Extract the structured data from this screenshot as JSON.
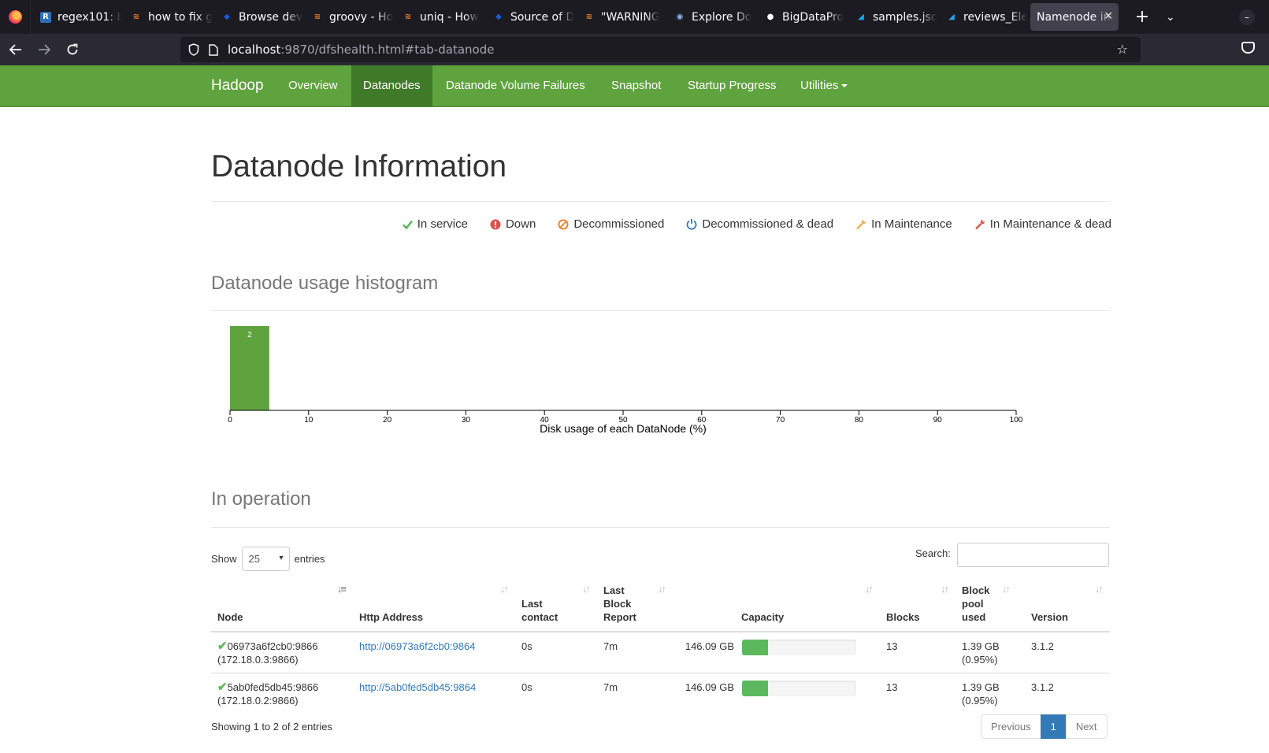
{
  "browser": {
    "tabs": [
      {
        "title": "regex101: b",
        "icon": "regex101-icon",
        "color": "#2f6fb5",
        "glyph": "R"
      },
      {
        "title": "how to fix g",
        "icon": "stackoverflow-icon",
        "color": "#f48024",
        "glyph": "≋"
      },
      {
        "title": "Browse dev",
        "icon": "bitwarden-shield-icon",
        "color": "#175ddc",
        "glyph": "◆"
      },
      {
        "title": "groovy - Ho",
        "icon": "stackoverflow-icon",
        "color": "#f48024",
        "glyph": "≋"
      },
      {
        "title": "uniq - How",
        "icon": "stackoverflow-icon",
        "color": "#f48024",
        "glyph": "≋"
      },
      {
        "title": "Source of D",
        "icon": "bitwarden-shield-icon",
        "color": "#175ddc",
        "glyph": "◆"
      },
      {
        "title": "\"WARNING",
        "icon": "stackoverflow-icon",
        "color": "#f48024",
        "glyph": "≋"
      },
      {
        "title": "Explore Do",
        "icon": "docker-icon",
        "color": "#8ab4f8",
        "glyph": "◉"
      },
      {
        "title": "BigDataPro",
        "icon": "github-icon",
        "color": "#ffffff",
        "glyph": "●"
      },
      {
        "title": "samples.jso",
        "icon": "elastic-icon",
        "color": "#1ba9f5",
        "glyph": "◢"
      },
      {
        "title": "reviews_Ele",
        "icon": "elastic-icon",
        "color": "#1ba9f5",
        "glyph": "◢"
      }
    ],
    "active_tab": {
      "title": "Namenode inf",
      "close": "×"
    },
    "new_tab": "+",
    "tab_list": "⌄",
    "url_host": "localhost",
    "url_rest": ":9870/dfshealth.html#tab-datanode"
  },
  "nav": {
    "brand": "Hadoop",
    "items": [
      "Overview",
      "Datanodes",
      "Datanode Volume Failures",
      "Snapshot",
      "Startup Progress",
      "Utilities"
    ]
  },
  "page": {
    "title": "Datanode Information",
    "legend": [
      {
        "label": "In service",
        "icon": "check-icon",
        "color": "#5cb85c"
      },
      {
        "label": "Down",
        "icon": "exclamation-circle-icon",
        "color": "#d9534f"
      },
      {
        "label": "Decommissioned",
        "icon": "ban-icon",
        "color": "#e67e22"
      },
      {
        "label": "Decommissioned & dead",
        "icon": "power-off-icon",
        "color": "#337ab7"
      },
      {
        "label": "In Maintenance",
        "icon": "wrench-icon",
        "color": "#f0ad4e"
      },
      {
        "label": "In Maintenance & dead",
        "icon": "wrench-icon",
        "color": "#d9534f"
      }
    ],
    "histogram_heading": "Datanode usage histogram",
    "operation_heading": "In operation"
  },
  "chart_data": {
    "type": "bar",
    "title": "",
    "xlabel": "Disk usage of each DataNode (%)",
    "ylabel": "",
    "xlim": [
      0,
      100
    ],
    "x_ticks": [
      "0",
      "10",
      "20",
      "30",
      "40",
      "50",
      "60",
      "70",
      "80",
      "90",
      "100"
    ],
    "bins": [
      {
        "from": 0,
        "to": 5,
        "count": 2
      }
    ],
    "bar_color": "#5fa33e"
  },
  "table": {
    "show_label": "Show",
    "entries_label": "entries",
    "page_size": "25",
    "search_label": "Search:",
    "columns": [
      "Node",
      "Http Address",
      "Last contact",
      "Last Block Report",
      "Capacity",
      "Blocks",
      "Block pool used",
      "Version"
    ],
    "rows": [
      {
        "node": "06973a6f2cb0:9866",
        "ip": "(172.18.0.3:9866)",
        "http": "http://06973a6f2cb0:9864",
        "last_contact": "0s",
        "last_block_report": "7m",
        "capacity": "146.09 GB",
        "used_fraction": 0.23,
        "blocks": "13",
        "bp_used": "1.39 GB",
        "bp_pct": "(0.95%)",
        "version": "3.1.2"
      },
      {
        "node": "5ab0fed5db45:9866",
        "ip": "(172.18.0.2:9866)",
        "http": "http://5ab0fed5db45:9864",
        "last_contact": "0s",
        "last_block_report": "7m",
        "capacity": "146.09 GB",
        "used_fraction": 0.23,
        "blocks": "13",
        "bp_used": "1.39 GB",
        "bp_pct": "(0.95%)",
        "version": "3.1.2"
      }
    ],
    "info": "Showing 1 to 2 of 2 entries",
    "pager": {
      "previous": "Previous",
      "current": "1",
      "next": "Next"
    }
  }
}
